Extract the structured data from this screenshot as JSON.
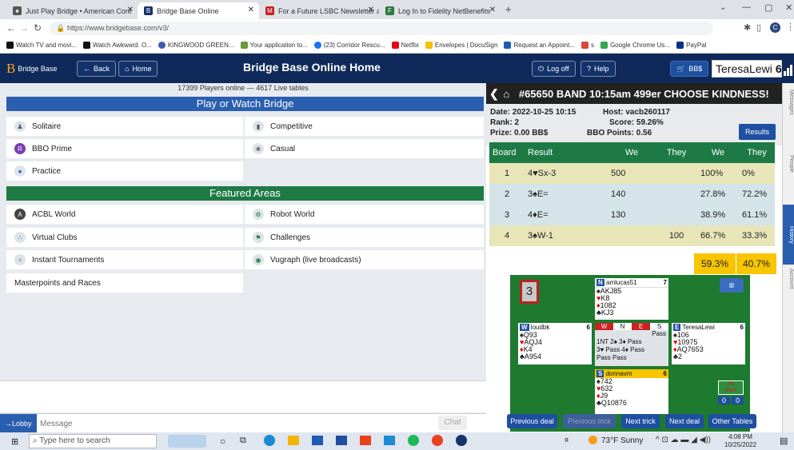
{
  "browser": {
    "tabs": [
      {
        "title": "Just Play Bridge • American Cont",
        "color": "#444"
      },
      {
        "title": "Bridge Base Online",
        "color": "#14336b"
      },
      {
        "title": "For a Future LSBC Newsletter and",
        "color": "#c5221f"
      },
      {
        "title": "Log In to Fidelity NetBenefits",
        "color": "#2b7a3a"
      }
    ],
    "url": "https://www.bridgebase.com/v3/",
    "bookmarks": [
      "Watch TV and movi...",
      "Watch Awkward. O...",
      "KINGWOOD GREEN...",
      "Your application to...",
      "(23) Corridor Rescu...",
      "Netflix",
      "Envelopes | DocuSign",
      "Request an Appoint...",
      "s",
      "Google Chrome Us...",
      "PayPal"
    ]
  },
  "header": {
    "logo": "Bridge Base",
    "back": "Back",
    "home": "Home",
    "title": "Bridge Base Online Home",
    "logoff": "Log off",
    "help": "Help",
    "bbs": "BB$",
    "user": "TeresaLewi",
    "user_num": "6"
  },
  "lobby": {
    "stats": "17399 Players online  —  4617 Live tables",
    "play_header": "Play or Watch Bridge",
    "play": [
      "Solitaire",
      "Competitive",
      "BBO Prime",
      "Casual",
      "Practice"
    ],
    "featured_header": "Featured Areas",
    "featured": [
      "ACBL World",
      "Robot World",
      "Virtual Clubs",
      "Challenges",
      "Instant Tournaments",
      "Vugraph (live broadcasts)"
    ],
    "masterpoints": "Masterpoints and Races",
    "lobby_tab": "→Lobby",
    "message_placeholder": "Message",
    "chat": "Chat"
  },
  "tournament": {
    "title": "#65650 BAND 10:15am 499er CHOOSE KINDNESS!",
    "date": "Date: 2022-10-25 10:15",
    "host": "Host: vacb260117",
    "rank": "Rank: 2",
    "score": "Score: 59.26%",
    "prize": "Prize: 0.00 BB$",
    "points": "BBO Points: 0.56",
    "results_btn": "Results",
    "columns": [
      "Board",
      "Result",
      "We",
      "They",
      "We",
      "They"
    ],
    "rows": [
      [
        "1",
        "4♥Sx-3",
        "500",
        "",
        "100%",
        "0%"
      ],
      [
        "2",
        "3♠E=",
        "140",
        "",
        "27.8%",
        "72.2%"
      ],
      [
        "3",
        "4♦E=",
        "130",
        "",
        "38.9%",
        "61.1%"
      ],
      [
        "4",
        "3♠W-1",
        "",
        "100",
        "66.7%",
        "33.3%"
      ]
    ],
    "total_we": "59.3%",
    "total_they": "40.7%"
  },
  "deal": {
    "board_num": "3",
    "north": {
      "name": "amlucas51",
      "num": "7",
      "S": "AKJ85",
      "H": "K8",
      "D": "1082",
      "C": "KJ3"
    },
    "west": {
      "name": "loudbk",
      "num": "6",
      "S": "Q93",
      "H": "AQJ4",
      "D": "K4",
      "C": "A954"
    },
    "east": {
      "name": "TeresaLewi",
      "num": "6",
      "S": "106",
      "H": "10975",
      "D": "AQ7653",
      "C": "2"
    },
    "south": {
      "name": "donnavm",
      "num": "6",
      "S": "742",
      "H": "632",
      "D": "J9",
      "C": "Q10876"
    },
    "bidding_head": [
      "W",
      "N",
      "E",
      "S"
    ],
    "bidding": [
      "Pass",
      "1NT 2♠ 3♦ Pass",
      "3♥ Pass 4♦ Pass",
      "Pass Pass"
    ],
    "trick_label": "4♦\nEast",
    "trick_we": "0",
    "trick_they": "0",
    "buttons": [
      "Previous deal",
      "Previous trick",
      "Next trick",
      "Next deal",
      "Other Tables"
    ]
  },
  "sidebar": [
    "Messages",
    "People",
    "History",
    "Account"
  ],
  "taskbar": {
    "search": "Type here to search",
    "weather": "73°F Sunny",
    "time": "4:08 PM",
    "date": "10/25/2022"
  }
}
